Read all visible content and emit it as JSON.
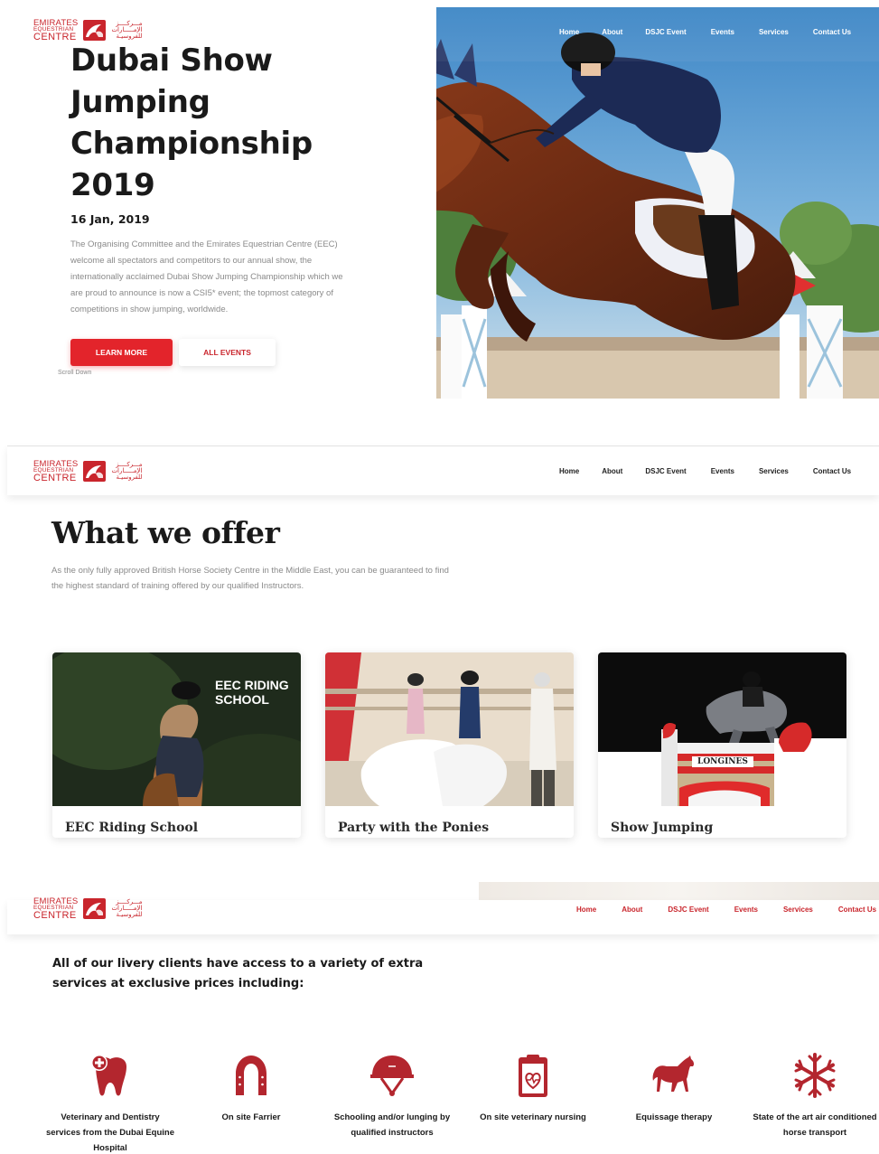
{
  "brand": {
    "name_line1": "EMIRATES",
    "name_line2": "EQUESTRIAN",
    "name_line3": "CENTRE",
    "arabic_line1": "مـــركــــز",
    "arabic_line2": "الإمـــــارات",
    "arabic_line3": "للفروسيـة",
    "color": "#c9252c"
  },
  "nav": {
    "items": [
      {
        "label": "Home"
      },
      {
        "label": "About"
      },
      {
        "label": "DSJC Event"
      },
      {
        "label": "Events"
      },
      {
        "label": "Services"
      },
      {
        "label": "Contact Us"
      }
    ]
  },
  "hero": {
    "title": "Dubai Show Jumping Championship 2019",
    "date": "16 Jan, 2019",
    "description": "The Organising Committee and the Emirates Equestrian Centre (EEC) welcome all spectators and competitors to our annual show, the internationally acclaimed Dubai Show Jumping Championship which we are proud to announce is now a CSI5* event; the topmost category of competitions in show jumping, worldwide.",
    "primary_button": "LEARN MORE",
    "secondary_button": "ALL EVENTS",
    "scroll_label": "Scroll Down",
    "accent_color": "#e3242b"
  },
  "offer": {
    "title": "What we offer",
    "description": "As the only fully approved British Horse Society Centre in the Middle East, you can be guaranteed to find the highest standard of training offered by our qualified Instructors.",
    "cards": [
      {
        "title": "EEC Riding School",
        "image_caption": "EEC RIDING SCHOOL"
      },
      {
        "title": "Party with the Ponies"
      },
      {
        "title": "Show Jumping",
        "banner_text": "LONGINES"
      }
    ]
  },
  "services": {
    "intro": "All of our livery clients have access to a variety of extra services at exclusive prices including:",
    "icon_color": "#b3262e",
    "items": [
      {
        "label": "Veterinary and Dentistry services from the Dubai Equine Hospital",
        "icon": "tooth-medical-icon"
      },
      {
        "label": "On site Farrier",
        "icon": "horseshoe-icon"
      },
      {
        "label": "Schooling and/or lunging by qualified instructors",
        "icon": "riding-helmet-icon"
      },
      {
        "label": "On site veterinary nursing",
        "icon": "clipboard-heart-icon"
      },
      {
        "label": "Equissage therapy",
        "icon": "horse-icon"
      },
      {
        "label": "State of the art air conditioned horse transport",
        "icon": "snowflake-icon"
      }
    ]
  }
}
